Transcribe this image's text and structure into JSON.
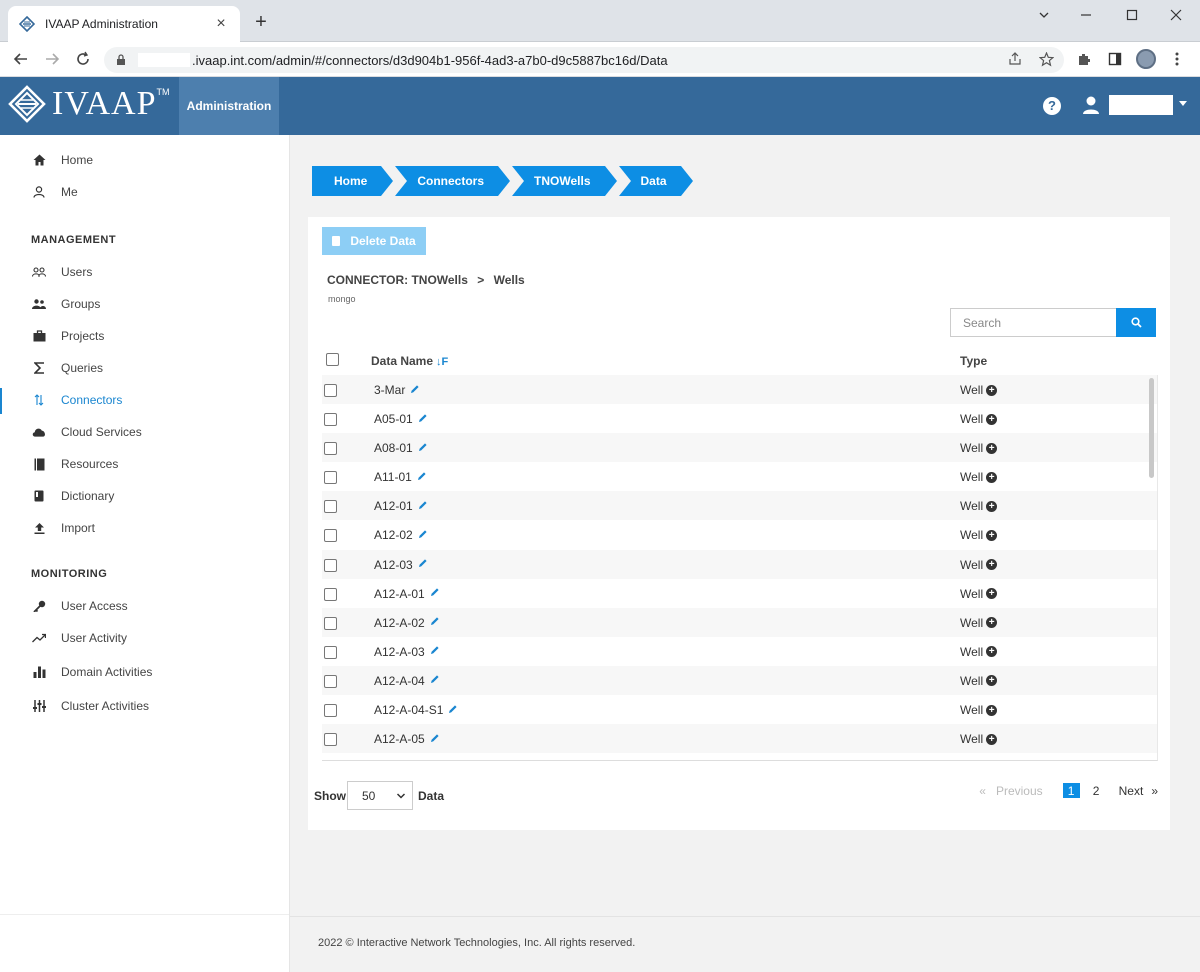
{
  "browser": {
    "tab_title": "IVAAP Administration",
    "tab_close": "×",
    "new_tab": "+",
    "url": ".ivaap.int.com/admin/#/connectors/d3d904b1-956f-4ad3-a7b0-d9c5887bc16d/Data"
  },
  "header": {
    "logo_text": "IVAAP",
    "logo_tm": "TM",
    "admin_label": "Administration",
    "help": "?"
  },
  "sidebar": {
    "top_items": [
      {
        "label": "Home",
        "icon": "home-icon"
      },
      {
        "label": "Me",
        "icon": "person-icon"
      }
    ],
    "management_heading": "MANAGEMENT",
    "management_items": [
      {
        "label": "Users",
        "icon": "users-icon"
      },
      {
        "label": "Groups",
        "icon": "groups-icon"
      },
      {
        "label": "Projects",
        "icon": "briefcase-icon"
      },
      {
        "label": "Queries",
        "icon": "sigma-icon"
      },
      {
        "label": "Connectors",
        "icon": "connectors-icon",
        "active": true
      },
      {
        "label": "Cloud Services",
        "icon": "cloud-icon"
      },
      {
        "label": "Resources",
        "icon": "book-icon"
      },
      {
        "label": "Dictionary",
        "icon": "dictionary-icon"
      },
      {
        "label": "Import",
        "icon": "upload-icon"
      }
    ],
    "monitoring_heading": "MONITORING",
    "monitoring_items": [
      {
        "label": "User Access",
        "icon": "key-icon"
      },
      {
        "label": "User Activity",
        "icon": "trend-icon"
      },
      {
        "label": "Domain Activities",
        "icon": "bar-chart-icon"
      },
      {
        "label": "Cluster Activities",
        "icon": "sliders-icon"
      }
    ]
  },
  "breadcrumb": [
    "Home",
    "Connectors",
    "TNOWells",
    "Data"
  ],
  "toolbar": {
    "delete_label": "Delete Data"
  },
  "connector": {
    "label": "CONNECTOR: TNOWells",
    "separator": ">",
    "section": "Wells",
    "sub": "mongo"
  },
  "search": {
    "placeholder": "Search"
  },
  "table": {
    "columns": [
      "Data Name",
      "Type"
    ],
    "sort_icon": "↓F",
    "rows": [
      {
        "name": "3-Mar",
        "type": "Well"
      },
      {
        "name": "A05-01",
        "type": "Well"
      },
      {
        "name": "A08-01",
        "type": "Well"
      },
      {
        "name": "A11-01",
        "type": "Well"
      },
      {
        "name": "A12-01",
        "type": "Well"
      },
      {
        "name": "A12-02",
        "type": "Well"
      },
      {
        "name": "A12-03",
        "type": "Well"
      },
      {
        "name": "A12-A-01",
        "type": "Well"
      },
      {
        "name": "A12-A-02",
        "type": "Well"
      },
      {
        "name": "A12-A-03",
        "type": "Well"
      },
      {
        "name": "A12-A-04",
        "type": "Well"
      },
      {
        "name": "A12-A-04-S1",
        "type": "Well"
      },
      {
        "name": "A12-A-05",
        "type": "Well"
      }
    ]
  },
  "pagination": {
    "show_label": "Show",
    "page_size": "50",
    "data_label": "Data",
    "prev_arrow": "«",
    "previous": "Previous",
    "pages": [
      "1",
      "2"
    ],
    "current_page": "1",
    "next": "Next",
    "next_arrow": "»"
  },
  "footer": {
    "text": "2022 © Interactive Network Technologies, Inc. All rights reserved."
  },
  "colors": {
    "header_bg": "#35699a",
    "accent": "#0d8ee4",
    "admin_tab": "#4d7fae"
  }
}
